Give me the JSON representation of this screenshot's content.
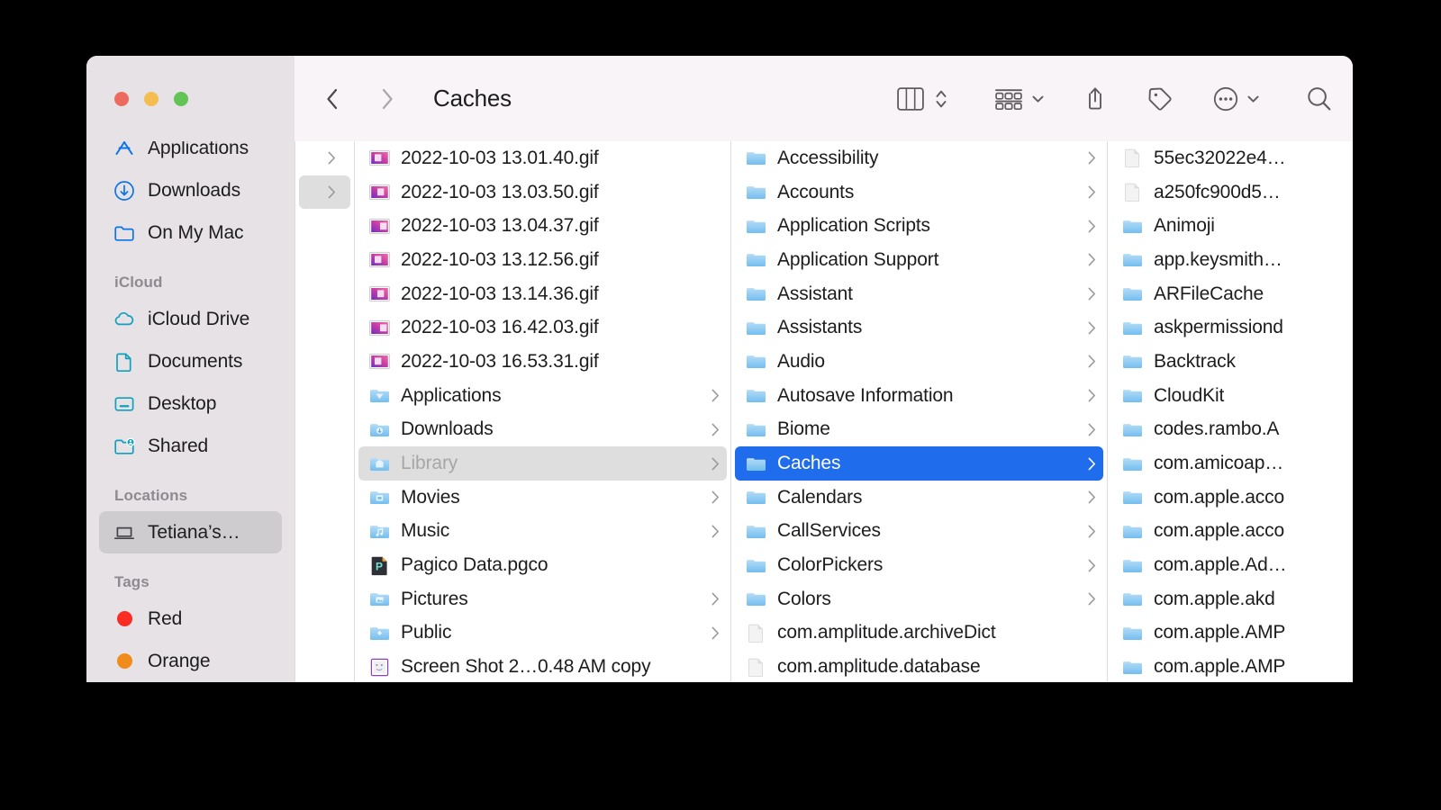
{
  "window": {
    "title": "Caches",
    "traffic_lights": [
      {
        "name": "close",
        "color": "#ec6a5e"
      },
      {
        "name": "minimize",
        "color": "#f4bd4f"
      },
      {
        "name": "maximize",
        "color": "#61c454"
      }
    ]
  },
  "toolbar": {
    "back_label": "Back",
    "forward_label": "Forward",
    "view_column_label": "Column View",
    "view_stepper_label": "View Options",
    "group_label": "Group",
    "group_caret_label": "Group Options",
    "share_label": "Share",
    "tag_label": "Tags",
    "more_label": "More",
    "more_caret_label": "More Options",
    "search_label": "Search"
  },
  "sidebar": {
    "groups": [
      {
        "header": "",
        "items": [
          {
            "label": "Applications",
            "icon": "applications-icon",
            "selected": false
          },
          {
            "label": "Downloads",
            "icon": "downloads-icon",
            "selected": false
          },
          {
            "label": "On My Mac",
            "icon": "folder-icon",
            "selected": false
          }
        ]
      },
      {
        "header": "iCloud",
        "items": [
          {
            "label": "iCloud Drive",
            "icon": "cloud-icon",
            "selected": false
          },
          {
            "label": "Documents",
            "icon": "document-icon",
            "selected": false
          },
          {
            "label": "Desktop",
            "icon": "desktop-icon",
            "selected": false
          },
          {
            "label": "Shared",
            "icon": "shared-folder-icon",
            "selected": false
          }
        ]
      },
      {
        "header": "Locations",
        "items": [
          {
            "label": "Tetiana’s…",
            "icon": "laptop-icon",
            "selected": true
          }
        ]
      },
      {
        "header": "Tags",
        "items": [
          {
            "label": "Red",
            "icon": "tag-dot-icon",
            "color": "#fb2c23",
            "selected": false
          },
          {
            "label": "Orange",
            "icon": "tag-dot-icon",
            "color": "#f08c1b",
            "selected": false
          }
        ]
      }
    ]
  },
  "columns": [
    {
      "name": "column-stub",
      "rows": [
        {
          "label": "",
          "icon": "",
          "chevron": true,
          "selected": "none"
        },
        {
          "label": "",
          "icon": "",
          "chevron": true,
          "selected": "grey"
        }
      ]
    },
    {
      "name": "column-home",
      "rows": [
        {
          "label": "2022-10-03 13.01.40.gif",
          "icon": "gif-preview-icon",
          "chevron": false,
          "selected": "none"
        },
        {
          "label": "2022-10-03 13.03.50.gif",
          "icon": "gif-preview-icon",
          "chevron": false,
          "selected": "none"
        },
        {
          "label": "2022-10-03 13.04.37.gif",
          "icon": "gif-preview-icon",
          "chevron": false,
          "selected": "none"
        },
        {
          "label": "2022-10-03 13.12.56.gif",
          "icon": "gif-preview-icon",
          "chevron": false,
          "selected": "none"
        },
        {
          "label": "2022-10-03 13.14.36.gif",
          "icon": "gif-preview-icon",
          "chevron": false,
          "selected": "none"
        },
        {
          "label": "2022-10-03 16.42.03.gif",
          "icon": "gif-preview-icon",
          "chevron": false,
          "selected": "none"
        },
        {
          "label": "2022-10-03 16.53.31.gif",
          "icon": "gif-preview-icon",
          "chevron": false,
          "selected": "none"
        },
        {
          "label": "Applications",
          "icon": "folder-applications-icon",
          "chevron": true,
          "selected": "none"
        },
        {
          "label": "Downloads",
          "icon": "folder-downloads-icon",
          "chevron": true,
          "selected": "none"
        },
        {
          "label": "Library",
          "icon": "folder-library-icon",
          "chevron": true,
          "selected": "grey"
        },
        {
          "label": "Movies",
          "icon": "folder-movies-icon",
          "chevron": true,
          "selected": "none"
        },
        {
          "label": "Music",
          "icon": "folder-music-icon",
          "chevron": true,
          "selected": "none"
        },
        {
          "label": "Pagico Data.pgco",
          "icon": "pagico-file-icon",
          "chevron": false,
          "selected": "none"
        },
        {
          "label": "Pictures",
          "icon": "folder-pictures-icon",
          "chevron": true,
          "selected": "none"
        },
        {
          "label": "Public",
          "icon": "folder-public-icon",
          "chevron": true,
          "selected": "none"
        },
        {
          "label": "Screen Shot 2…0.48 AM copy",
          "icon": "screenshot-preview-icon",
          "chevron": false,
          "selected": "none"
        }
      ]
    },
    {
      "name": "column-library",
      "rows": [
        {
          "label": "Accessibility",
          "icon": "folder-icon",
          "chevron": true,
          "selected": "none"
        },
        {
          "label": "Accounts",
          "icon": "folder-icon",
          "chevron": true,
          "selected": "none"
        },
        {
          "label": "Application Scripts",
          "icon": "folder-icon",
          "chevron": true,
          "selected": "none"
        },
        {
          "label": "Application Support",
          "icon": "folder-icon",
          "chevron": true,
          "selected": "none"
        },
        {
          "label": "Assistant",
          "icon": "folder-icon",
          "chevron": true,
          "selected": "none"
        },
        {
          "label": "Assistants",
          "icon": "folder-icon",
          "chevron": true,
          "selected": "none"
        },
        {
          "label": "Audio",
          "icon": "folder-icon",
          "chevron": true,
          "selected": "none"
        },
        {
          "label": "Autosave Information",
          "icon": "folder-icon",
          "chevron": true,
          "selected": "none"
        },
        {
          "label": "Biome",
          "icon": "folder-icon",
          "chevron": true,
          "selected": "none"
        },
        {
          "label": "Caches",
          "icon": "folder-icon",
          "chevron": true,
          "selected": "blue"
        },
        {
          "label": "Calendars",
          "icon": "folder-icon",
          "chevron": true,
          "selected": "none"
        },
        {
          "label": "CallServices",
          "icon": "folder-icon",
          "chevron": true,
          "selected": "none"
        },
        {
          "label": "ColorPickers",
          "icon": "folder-icon",
          "chevron": true,
          "selected": "none"
        },
        {
          "label": "Colors",
          "icon": "folder-icon",
          "chevron": true,
          "selected": "none"
        },
        {
          "label": "com.amplitude.archiveDict",
          "icon": "generic-file-icon",
          "chevron": false,
          "selected": "none"
        },
        {
          "label": "com.amplitude.database",
          "icon": "generic-file-icon",
          "chevron": false,
          "selected": "none"
        }
      ]
    },
    {
      "name": "column-caches",
      "rows": [
        {
          "label": "55ec32022e4…",
          "icon": "generic-file-icon",
          "chevron": false,
          "selected": "none"
        },
        {
          "label": "a250fc900d5…",
          "icon": "generic-file-icon",
          "chevron": false,
          "selected": "none"
        },
        {
          "label": "Animoji",
          "icon": "folder-icon",
          "chevron": false,
          "selected": "none"
        },
        {
          "label": "app.keysmith…",
          "icon": "folder-icon",
          "chevron": false,
          "selected": "none"
        },
        {
          "label": "ARFileCache",
          "icon": "folder-icon",
          "chevron": false,
          "selected": "none"
        },
        {
          "label": "askpermissiond",
          "icon": "folder-icon",
          "chevron": false,
          "selected": "none"
        },
        {
          "label": "Backtrack",
          "icon": "folder-icon",
          "chevron": false,
          "selected": "none"
        },
        {
          "label": "CloudKit",
          "icon": "folder-icon",
          "chevron": false,
          "selected": "none"
        },
        {
          "label": "codes.rambo.A",
          "icon": "folder-icon",
          "chevron": false,
          "selected": "none"
        },
        {
          "label": "com.amicoap…",
          "icon": "folder-icon",
          "chevron": false,
          "selected": "none"
        },
        {
          "label": "com.apple.acco",
          "icon": "folder-icon",
          "chevron": false,
          "selected": "none"
        },
        {
          "label": "com.apple.acco",
          "icon": "folder-icon",
          "chevron": false,
          "selected": "none"
        },
        {
          "label": "com.apple.Ad…",
          "icon": "folder-icon",
          "chevron": false,
          "selected": "none"
        },
        {
          "label": "com.apple.akd",
          "icon": "folder-icon",
          "chevron": false,
          "selected": "none"
        },
        {
          "label": "com.apple.AMP",
          "icon": "folder-icon",
          "chevron": false,
          "selected": "none"
        },
        {
          "label": "com.apple.AMP",
          "icon": "folder-icon",
          "chevron": false,
          "selected": "none"
        }
      ]
    }
  ],
  "colors": {
    "selection_blue": "#1f6ded",
    "sidebar_bg": "#e6e2e6",
    "toolbar_bg": "#f9f4f8",
    "icloud_teal": "#12a0bd",
    "sidebar_blue": "#0b74e8"
  }
}
